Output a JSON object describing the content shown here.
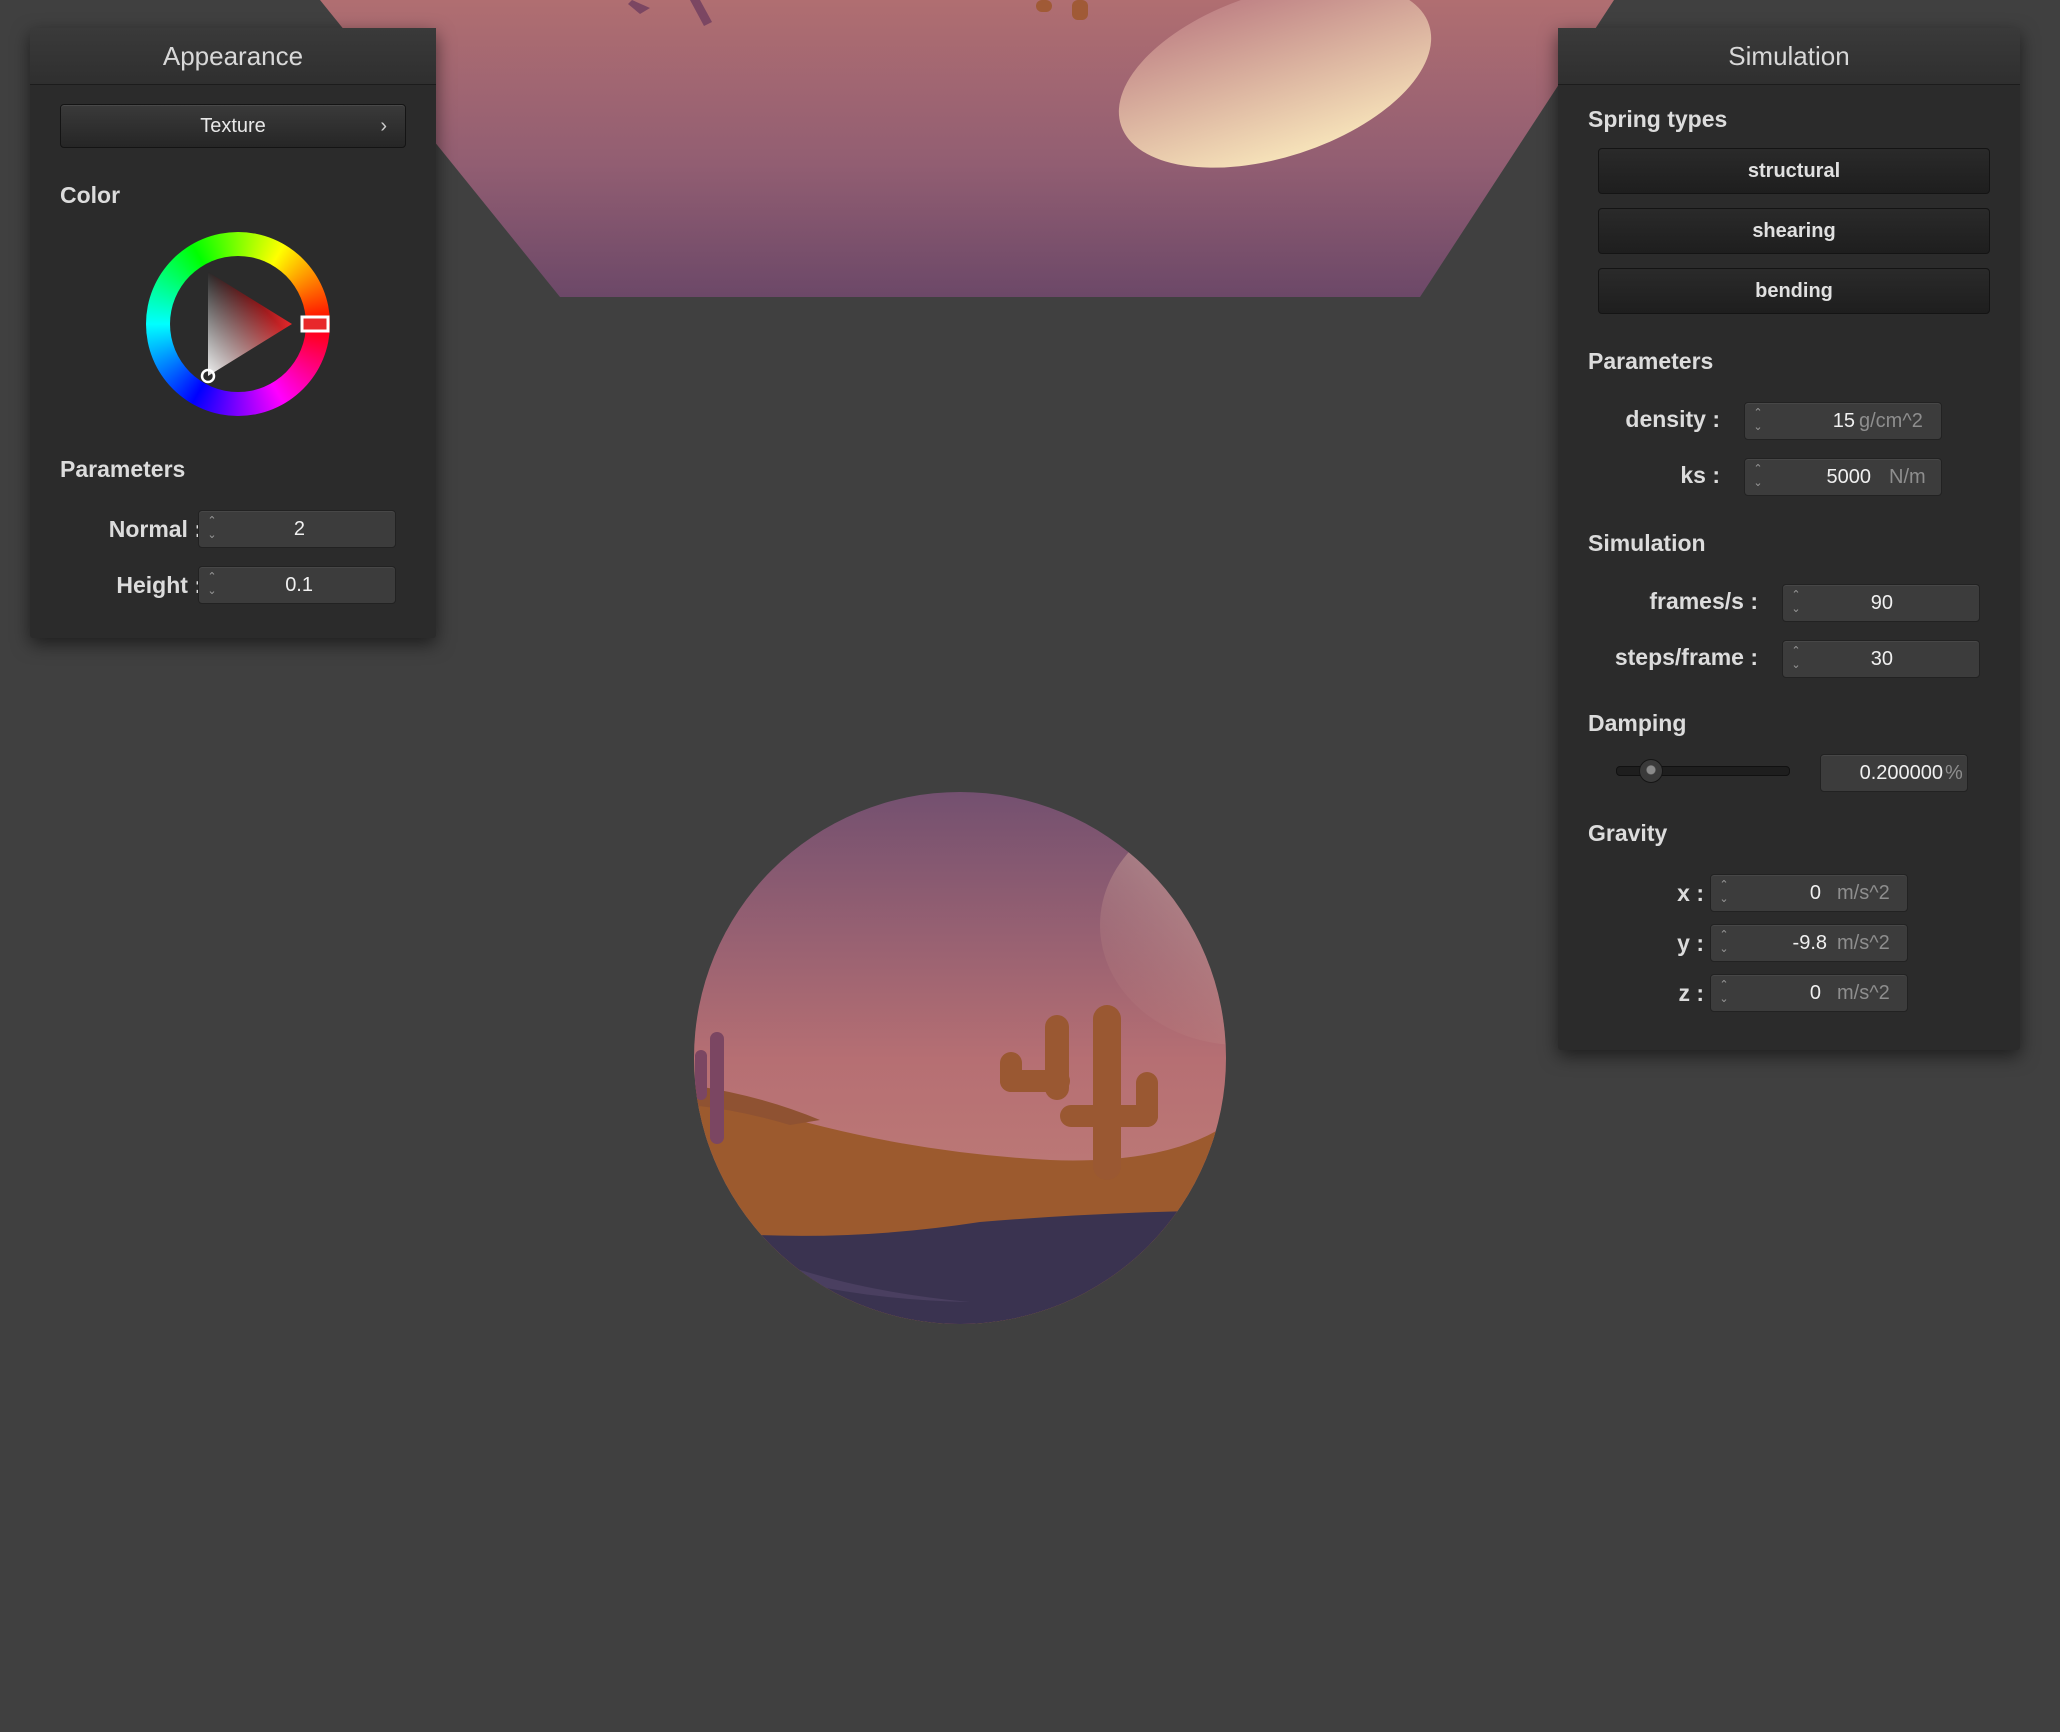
{
  "appearance": {
    "title": "Appearance",
    "texture_button": "Texture",
    "color_label": "Color",
    "parameters_label": "Parameters",
    "normal": {
      "label": "Normal :",
      "value": "2"
    },
    "height": {
      "label": "Height :",
      "value": "0.1"
    },
    "selected_color": "#e8282b"
  },
  "simulation_panel": {
    "title": "Simulation",
    "spring_types_label": "Spring types",
    "spring_buttons": [
      "structural",
      "shearing",
      "bending"
    ],
    "parameters_label": "Parameters",
    "density": {
      "label": "density :",
      "value": "15",
      "unit": "g/cm^2"
    },
    "ks": {
      "label": "ks :",
      "value": "5000",
      "unit": "N/m"
    },
    "simulation_label": "Simulation",
    "fps": {
      "label": "frames/s :",
      "value": "90"
    },
    "steps": {
      "label": "steps/frame :",
      "value": "30"
    },
    "damping_label": "Damping",
    "damping": {
      "value": "0.200000",
      "unit": "%",
      "slider_fraction": 0.2
    },
    "gravity_label": "Gravity",
    "gravity": [
      {
        "label": "x :",
        "value": "0",
        "unit": "m/s^2"
      },
      {
        "label": "y :",
        "value": "-9.8",
        "unit": "m/s^2"
      },
      {
        "label": "z :",
        "value": "0",
        "unit": "m/s^2"
      }
    ]
  },
  "scene": {
    "background": "#404040",
    "sky_top": "#b06d70",
    "sky_bottom": "#6c4868",
    "sand": "#9c5a2e",
    "ground": "#3a3350",
    "cactus": "#9a5832"
  }
}
